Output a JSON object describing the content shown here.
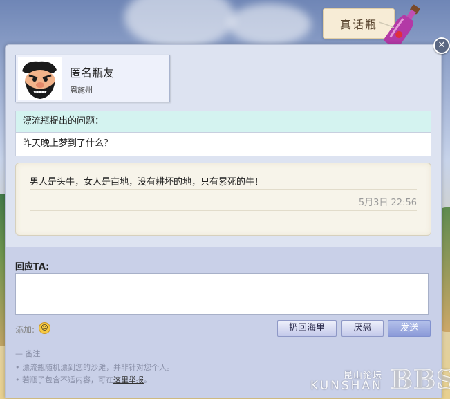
{
  "header": {
    "tab_label": "真话瓶"
  },
  "dialog": {
    "close_glyph": "✕"
  },
  "profile": {
    "name": "匿名瓶友",
    "location": "恩施州"
  },
  "question": {
    "heading": "漂流瓶提出的问题：",
    "text": "昨天晚上梦到了什么？"
  },
  "answer": {
    "text": "男人是头牛，女人是亩地，没有耕坏的地，只有累死的牛！",
    "timestamp": "5月3日 22:56"
  },
  "reply": {
    "label": "回应TA:",
    "value": "",
    "add_label": "添加:",
    "buttons": {
      "throw_back": "扔回海里",
      "dislike": "厌恶",
      "send": "发送"
    }
  },
  "notes": {
    "heading": "— 备注",
    "line1": "• 漂流瓶随机漂到您的沙滩，并非针对您个人。",
    "line2_prefix": "• 若瓶子包含不适内容，可在",
    "line2_link": "这里举报",
    "line2_suffix": "。"
  },
  "watermark": {
    "cn": "昆山论坛",
    "en": "KUNSHAN",
    "bbs": "BBS"
  },
  "colors": {
    "dialog_bg": "#dde3f1",
    "question_head": "#d4f3f0",
    "send_button": "#8b9ad8"
  }
}
